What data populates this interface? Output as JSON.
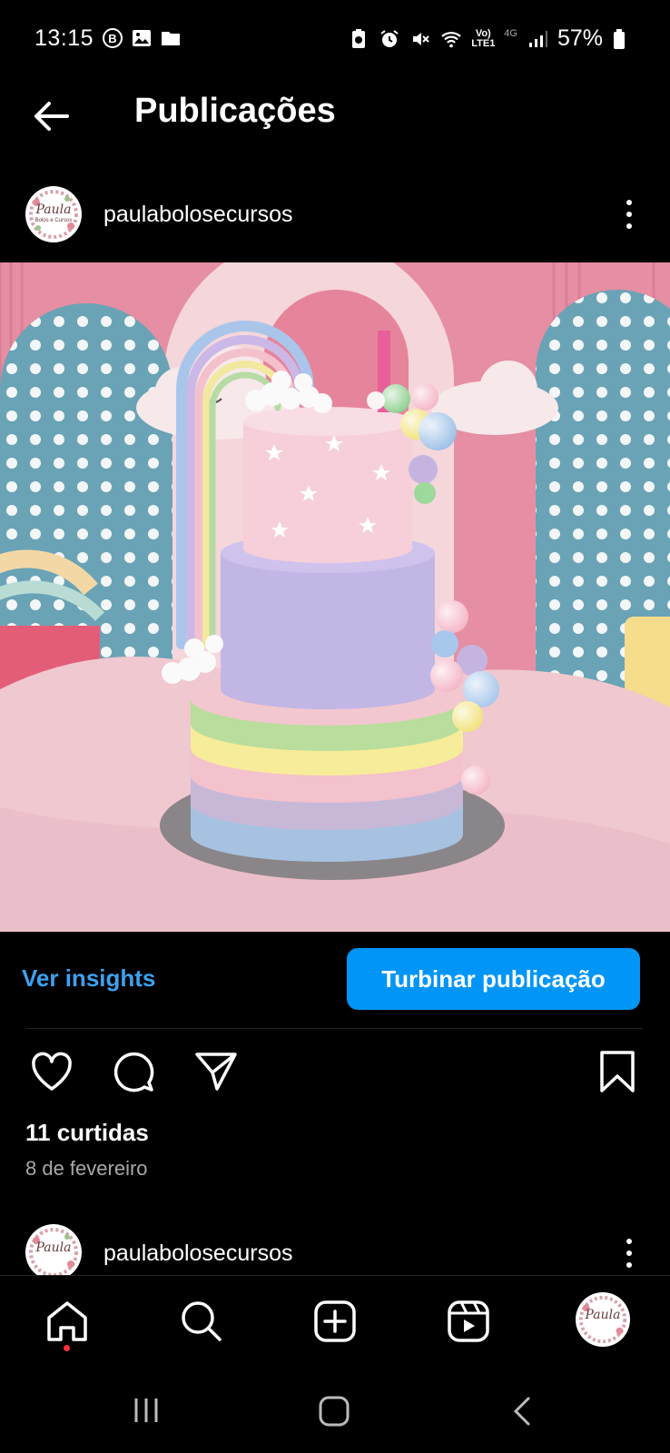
{
  "status_bar": {
    "time": "13:15",
    "battery": "57%",
    "network_label": "4G",
    "lte_label": "Vo) LTE1"
  },
  "header": {
    "title": "Publicações"
  },
  "post": {
    "username": "paulabolosecursos",
    "avatar_text": "Paula",
    "avatar_subtext": "Bolos e Cursos",
    "insights_label": "Ver insights",
    "boost_label": "Turbinar publicação",
    "likes": "11 curtidas",
    "date": "8 de fevereiro"
  },
  "next_post": {
    "username": "paulabolosecursos"
  },
  "colors": {
    "accent_blue": "#0095f6",
    "link_blue": "#3ea1f0",
    "background": "#000000",
    "notification_dot": "#ff3040"
  },
  "icons": [
    "back-arrow-icon",
    "heart-icon",
    "comment-icon",
    "share-icon",
    "bookmark-icon",
    "home-icon",
    "search-icon",
    "create-icon",
    "reels-icon",
    "profile-avatar"
  ]
}
